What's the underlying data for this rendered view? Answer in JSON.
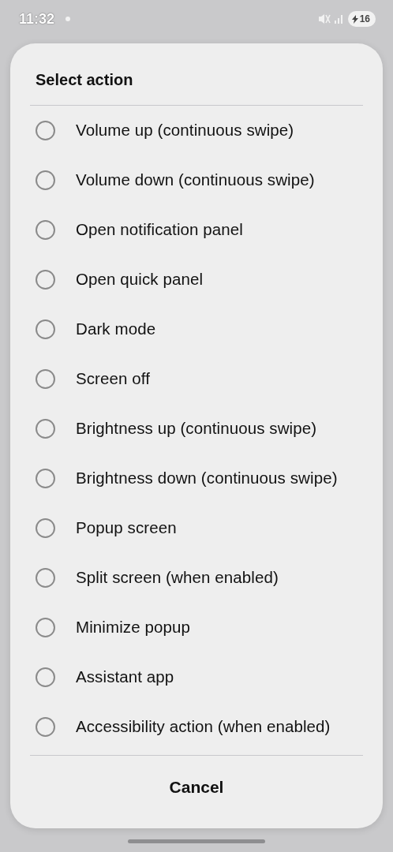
{
  "status_bar": {
    "time": "11:32",
    "battery": "16",
    "charging": true
  },
  "dialog": {
    "title": "Select action",
    "options": [
      {
        "label": "Volume up (continuous swipe)",
        "selected": false
      },
      {
        "label": "Volume down (continuous swipe)",
        "selected": false
      },
      {
        "label": "Open notification panel",
        "selected": false
      },
      {
        "label": "Open quick panel",
        "selected": false
      },
      {
        "label": "Dark mode",
        "selected": false
      },
      {
        "label": "Screen off",
        "selected": false
      },
      {
        "label": "Brightness up (continuous swipe)",
        "selected": false
      },
      {
        "label": "Brightness down (continuous swipe)",
        "selected": false
      },
      {
        "label": "Popup screen",
        "selected": false
      },
      {
        "label": "Split screen (when enabled)",
        "selected": false
      },
      {
        "label": "Minimize popup",
        "selected": false
      },
      {
        "label": "Assistant app",
        "selected": false
      },
      {
        "label": "Accessibility action (when enabled)",
        "selected": false
      }
    ],
    "buttons": [
      "Cancel"
    ]
  }
}
